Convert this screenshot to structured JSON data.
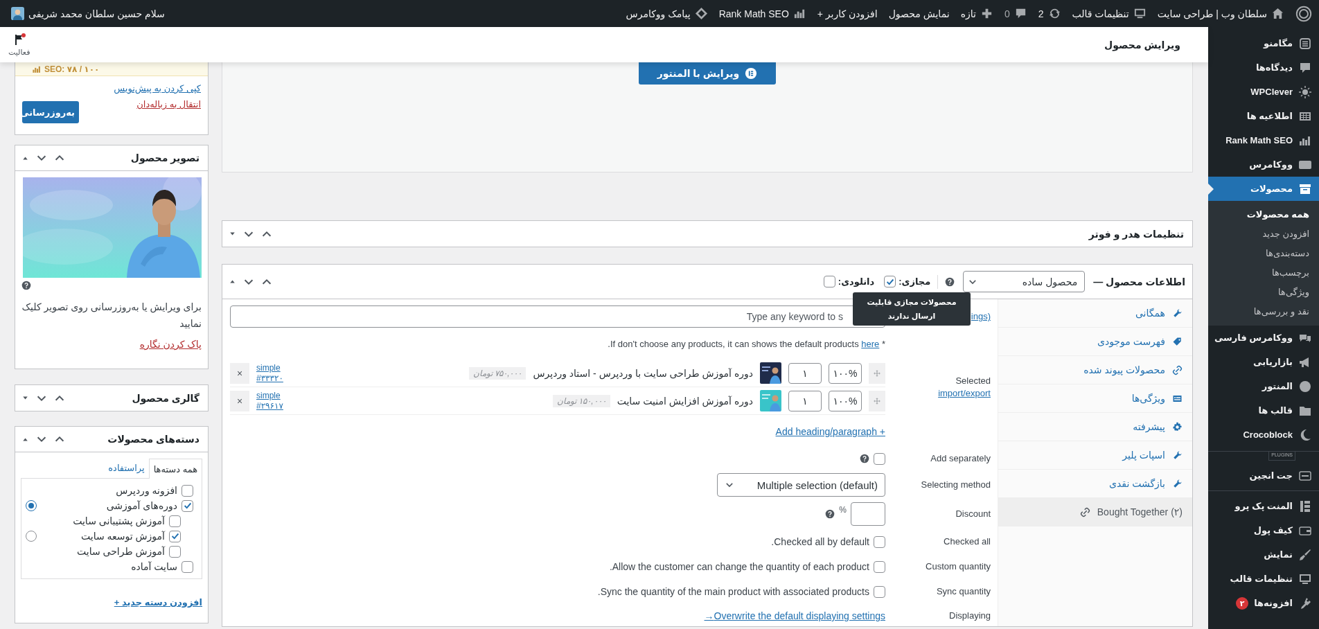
{
  "admin_bar": {
    "items": [
      {
        "label": "سلطان وب | طراحی سایت"
      },
      {
        "label": "تنظیمات قالب"
      },
      {
        "label": "2"
      },
      {
        "label": "0"
      },
      {
        "label": "تازه"
      },
      {
        "label": "نمایش محصول"
      },
      {
        "label": "افزودن کاربر +"
      },
      {
        "label": "Rank Math SEO"
      },
      {
        "label": "پیامک ووکامرس"
      }
    ],
    "greeting": "سلام حسین سلطان محمد شریفی"
  },
  "sidebar": {
    "items": [
      {
        "kind": "item",
        "label": "مگامنو",
        "selected": false
      },
      {
        "kind": "item",
        "label": "دیدگاه‌ها",
        "selected": false
      },
      {
        "kind": "item",
        "label": "WPClever",
        "selected": false
      },
      {
        "kind": "item",
        "label": "اطلاعیه ها",
        "selected": false
      },
      {
        "kind": "item",
        "label": "Rank Math SEO",
        "selected": false
      },
      {
        "kind": "item",
        "label": "ووکامرس",
        "selected": false
      },
      {
        "kind": "item",
        "label": "محصولات",
        "selected": true,
        "children": [
          {
            "label": "همه محصولات",
            "selected": true
          },
          {
            "label": "افزودن جدید",
            "selected": false
          },
          {
            "label": "دسته‌بندی‌ها",
            "selected": false
          },
          {
            "label": "برچسب‌ها",
            "selected": false
          },
          {
            "label": "ویژگی‌ها",
            "selected": false
          },
          {
            "label": "نقد و بررسی‌ها",
            "selected": false
          }
        ]
      },
      {
        "kind": "item",
        "label": "ووکامرس فارسی",
        "selected": false
      },
      {
        "kind": "item",
        "label": "بازاریابی",
        "selected": false
      },
      {
        "kind": "item",
        "label": "المنتور",
        "selected": false
      },
      {
        "kind": "item",
        "label": "قالب ها",
        "selected": false
      },
      {
        "kind": "item",
        "label": "Crocoblock",
        "selected": false
      },
      {
        "kind": "separator",
        "label": "PLUGINS"
      },
      {
        "kind": "item",
        "label": "جت انجین",
        "selected": false
      },
      {
        "kind": "separator"
      },
      {
        "kind": "item",
        "label": "المنت پک پرو",
        "selected": false
      },
      {
        "kind": "item",
        "label": "کیف پول",
        "selected": false
      },
      {
        "kind": "item",
        "label": "نمایش",
        "selected": false
      },
      {
        "kind": "item",
        "label": "تنظیمات قالب",
        "selected": false
      },
      {
        "kind": "item",
        "label": "افزونه‌ها",
        "selected": false,
        "badge": "۲"
      }
    ]
  },
  "page_header": {
    "title": "ویرایش محصول",
    "activity": "فعالیت"
  },
  "elementor": {
    "button": "ویرایش با المنتور"
  },
  "header_footer_box": {
    "title": "تنظیمات هدر و فوتر",
    "expanded": false
  },
  "product_data": {
    "title": "اطلاعات محصول —",
    "expanded": true,
    "type": "محصول ساده",
    "virtual": {
      "label": "مجازی:",
      "checked": true
    },
    "downloadable": {
      "label": "دانلودی:",
      "checked": false
    },
    "tooltip": "محصولات مجازی قابلیت ارسال ندارند",
    "tabs": [
      {
        "label": "همگانی",
        "selected": false
      },
      {
        "label": "فهرست موجودی",
        "selected": false
      },
      {
        "label": "محصولات پیوند شده",
        "selected": false
      },
      {
        "label": "ویژگی‌ها",
        "selected": false
      },
      {
        "label": "پیشرفته",
        "selected": false
      },
      {
        "label": "اسپات پلیر",
        "selected": false
      },
      {
        "label": "بازگشت نقدی",
        "selected": false
      },
      {
        "label": "Bought Together (۲)",
        "selected": true,
        "kind": "ltr"
      }
    ],
    "rows": [
      {
        "kind": "search",
        "placeholder": "Type any keyword to s",
        "link": "ings)"
      },
      {
        "kind": "note",
        "text": "* If don't choose any products, it can shows the default products ",
        "link": "here",
        "end": "."
      },
      {
        "kind": "products",
        "label": "Selected",
        "link": "import/export",
        "items": [
          {
            "percent": "۱۰۰%",
            "qty": "۱",
            "name": "دوره آموزش طراحی سایت با وردپرس - استاد وردپرس",
            "price": "۷۵۰,۰۰۰ تومان",
            "type": "simple",
            "id": "#۳۳۳۲۰",
            "remove": "×"
          },
          {
            "percent": "۱۰۰%",
            "qty": "۱",
            "name": "دوره آموزش افزایش امنیت سایت",
            "price": "۱۵۰,۰۰۰ تومان",
            "type": "simple",
            "id": "#۲۹۶۱۷",
            "remove": "×"
          }
        ]
      },
      {
        "kind": "add-link",
        "link": "+ Add heading/paragraph"
      },
      {
        "kind": "checkbox",
        "label": "Add separately",
        "checked": false,
        "help": true
      },
      {
        "kind": "select",
        "label": "Selecting method",
        "value": "Multiple selection (default)"
      },
      {
        "kind": "discount",
        "label": "Discount",
        "unit": "%",
        "help": true
      },
      {
        "kind": "checkbox",
        "label": "Checked all",
        "text": "Checked all by default.",
        "checked": false
      },
      {
        "kind": "checkbox",
        "label": "Custom quantity",
        "text": "Allow the customer can change the quantity of each product.",
        "checked": false
      },
      {
        "kind": "checkbox",
        "label": "Sync quantity",
        "text": "Sync the quantity of the main product with associated products.",
        "checked": false
      },
      {
        "kind": "link",
        "label": "Displaying",
        "link": "Overwrite the default displaying settings→"
      }
    ]
  },
  "publish_box": {
    "seo": "SEO: ۷۸ / ۱۰۰",
    "copy_link": "کپی کردن به پیش‌نویس",
    "trash_link": "انتقال به زباله‌دان",
    "update_button": "به‌روزرسانی"
  },
  "image_box": {
    "title": "تصویر محصول",
    "expanded": true,
    "hint": "برای ویرایش یا به‌روزرسانی روی تصویر کلیک نمایید",
    "remove_link": "پاک کردن نگاره"
  },
  "gallery_box": {
    "title": "گالری محصول",
    "expanded": false
  },
  "categories_box": {
    "title": "دسته‌های محصولات",
    "expanded": true,
    "tabs": [
      {
        "label": "همه دسته‌ها",
        "selected": true
      },
      {
        "label": "پراستفاده",
        "selected": false
      }
    ],
    "items": [
      {
        "label": "افزونه وردپرس",
        "checked": false
      },
      {
        "label": "دوره‌های آموزشی",
        "checked": true,
        "primary": true,
        "children": [
          {
            "label": "آموزش پشتیبانی سایت",
            "checked": false
          },
          {
            "label": "آموزش توسعه سایت",
            "checked": true,
            "primary": false
          },
          {
            "label": "آموزش طراحی سایت",
            "checked": false
          }
        ]
      },
      {
        "label": "سایت آماده",
        "checked": false
      }
    ],
    "add_link": "افزودن دسته جدید +"
  }
}
